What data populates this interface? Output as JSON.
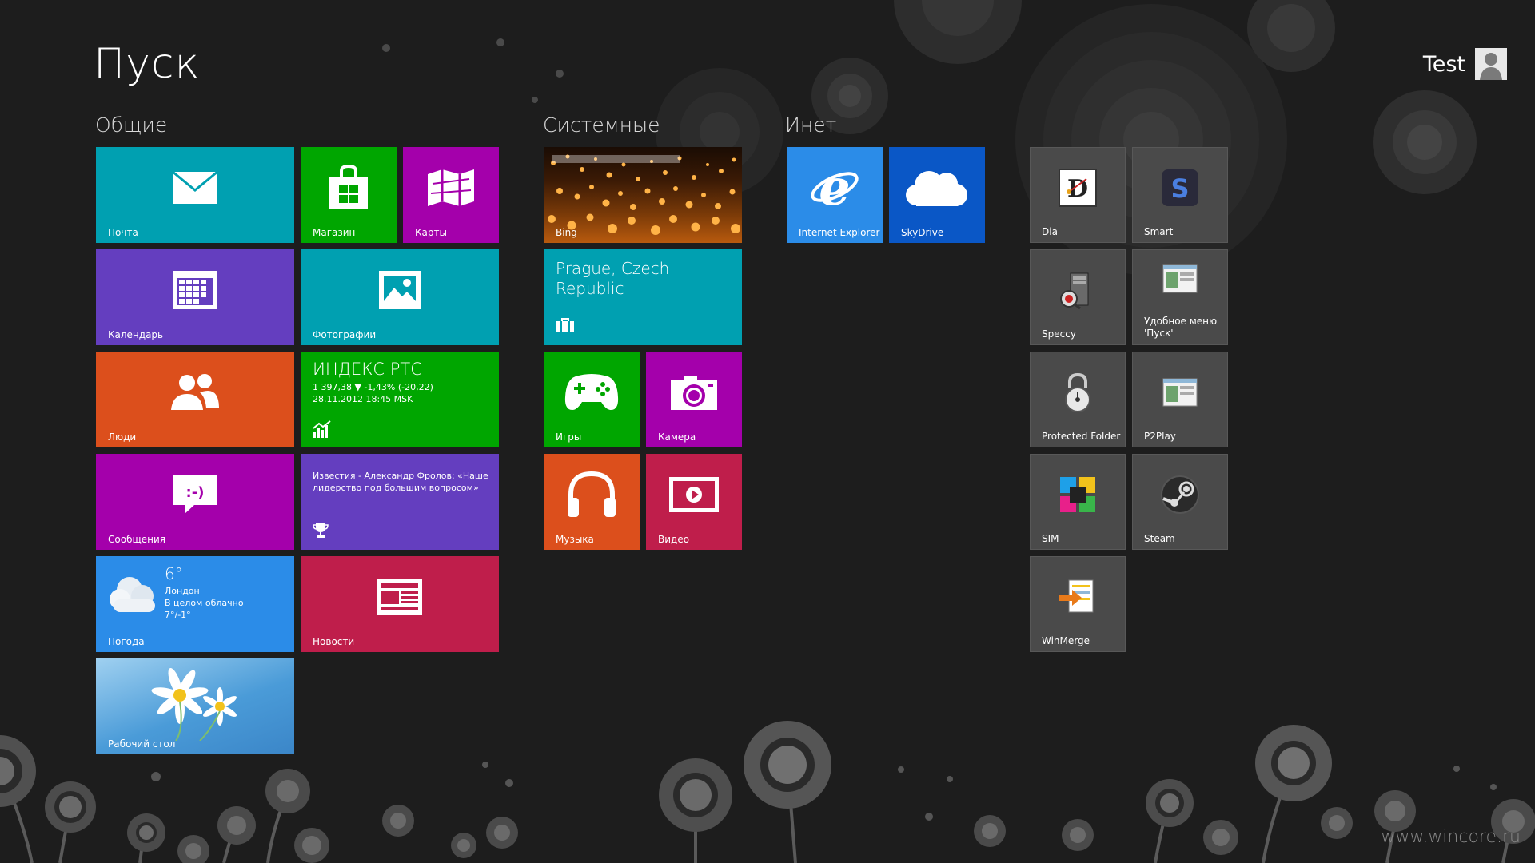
{
  "header": {
    "title": "Пуск",
    "user_name": "Test"
  },
  "groups": {
    "common": "Общие",
    "system": "Системные",
    "inet": "Инет"
  },
  "tiles": {
    "mail": "Почта",
    "store": "Магазин",
    "maps": "Карты",
    "calendar": "Календарь",
    "photos": "Фотографии",
    "people": "Люди",
    "finance": {
      "title": "ИНДЕКС РТС",
      "line1": "1 397,38  ▼ -1,43% (-20,22)",
      "line2": "28.11.2012 18:45 MSK"
    },
    "messages": "Сообщения",
    "sports": {
      "headline": "Известия - Александр Фролов: «Наше лидерство под большим вопросом»"
    },
    "weather": {
      "label": "Погода",
      "temp": "6°",
      "city": "Лондон",
      "cond": "В целом облачно",
      "range": "7°/-1°"
    },
    "news": "Новости",
    "desktop": "Рабочий стол",
    "bing": "Bing",
    "travel": {
      "place": "Prague, Czech Republic"
    },
    "games": "Игры",
    "camera": "Камера",
    "music": "Музыка",
    "video": "Видео",
    "ie": "Internet Explorer",
    "skydrive": "SkyDrive",
    "dia": "Dia",
    "smart": "Smart",
    "speccy": "Speccy",
    "start_menu": "Удобное меню 'Пуск'",
    "protected_folder": "Protected Folder",
    "p2play": "P2Play",
    "sim": "SIM",
    "steam": "Steam",
    "winmerge": "WinMerge"
  },
  "watermark": "www.wincore.ru",
  "colors": {
    "background": "#1d1d1d",
    "teal": "#00a0b1",
    "green": "#00a600",
    "magenta": "#a400ab",
    "purple": "#643ebf",
    "orange": "#dc4f1c",
    "crimson": "#bf1e4b",
    "blue": "#2b8ce8",
    "desktop_tile": "#5aa7de",
    "gray_tile": "#4a4a4a"
  }
}
